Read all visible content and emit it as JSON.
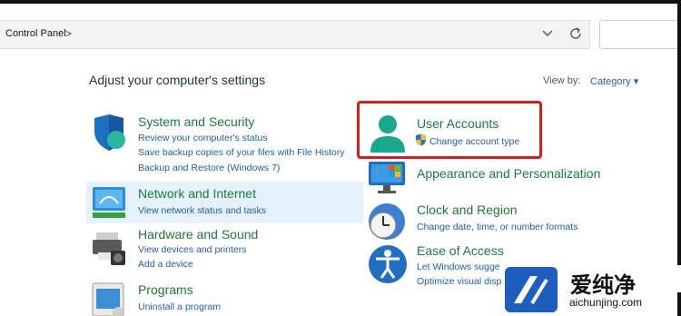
{
  "address": {
    "crumb": "Control Panel",
    "separator": ">"
  },
  "main": {
    "heading": "Adjust your computer's settings",
    "view_by_label": "View by:",
    "view_by_value": "Category ▾"
  },
  "left": [
    {
      "title": "System and Security",
      "links": [
        "Review your computer's status",
        "Save backup copies of your files with File History",
        "Backup and Restore (Windows 7)"
      ]
    },
    {
      "title": "Network and Internet",
      "links": [
        "View network status and tasks"
      ]
    },
    {
      "title": "Hardware and Sound",
      "links": [
        "View devices and printers",
        "Add a device"
      ]
    },
    {
      "title": "Programs",
      "links": [
        "Uninstall a program"
      ]
    }
  ],
  "right": [
    {
      "title": "User Accounts",
      "links": [
        "Change account type"
      ]
    },
    {
      "title": "Appearance and Personalization",
      "links": []
    },
    {
      "title": "Clock and Region",
      "links": [
        "Change date, time, or number formats"
      ]
    },
    {
      "title": "Ease of Access",
      "links": [
        "Let Windows sugge",
        "Optimize visual disp"
      ]
    }
  ],
  "watermark": {
    "brand": "爱纯净",
    "url": "aichunjing.com"
  },
  "colors": {
    "category_title": "#1a7d36",
    "link": "#1e5fa8",
    "highlight_border": "#d91c1c"
  }
}
